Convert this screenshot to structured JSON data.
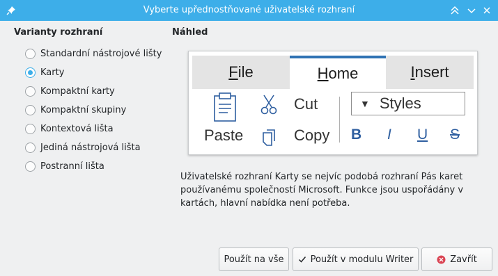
{
  "window": {
    "title": "Vyberte upřednostňované uživatelské rozhraní",
    "pin_icon": "pin-icon",
    "controls": [
      "chevron-up-icon",
      "chevron-down-icon",
      "close-icon"
    ]
  },
  "variants": {
    "heading": "Varianty rozhraní",
    "options": [
      {
        "label": "Standardní nástrojové lišty",
        "checked": false
      },
      {
        "label": "Karty",
        "checked": true
      },
      {
        "label": "Kompaktní karty",
        "checked": false
      },
      {
        "label": "Kompaktní skupiny",
        "checked": false
      },
      {
        "label": "Kontextová lišta",
        "checked": false
      },
      {
        "label": "Jediná nástrojová lišta",
        "checked": false
      },
      {
        "label": "Postranní lišta",
        "checked": false
      }
    ]
  },
  "preview": {
    "heading": "Náhled",
    "tabs": {
      "file": {
        "underlined": "F",
        "rest": "ile"
      },
      "home": {
        "underlined": "H",
        "rest": "ome"
      },
      "insert": {
        "underlined": "I",
        "rest": "nsert"
      }
    },
    "paste": "Paste",
    "cut": "Cut",
    "copy": "Copy",
    "styles": "Styles",
    "styles_arrow": "▼",
    "bold": "B",
    "italic": "I",
    "underline": "U",
    "strike": "S"
  },
  "description": "Uživatelské rozhraní Karty se nejvíc podobá rozhraní Pás karet používanému společností Microsoft. Funkce jsou uspořádány v kartách, hlavní nabídka není potřeba.",
  "buttons": {
    "apply_all": "Použít na vše",
    "apply_writer": "Použít v modulu Writer",
    "close": "Zavřít"
  },
  "colors": {
    "accent": "#3daee9",
    "close_icon": "#da4453",
    "preview_icon": "#2f5fa0"
  }
}
